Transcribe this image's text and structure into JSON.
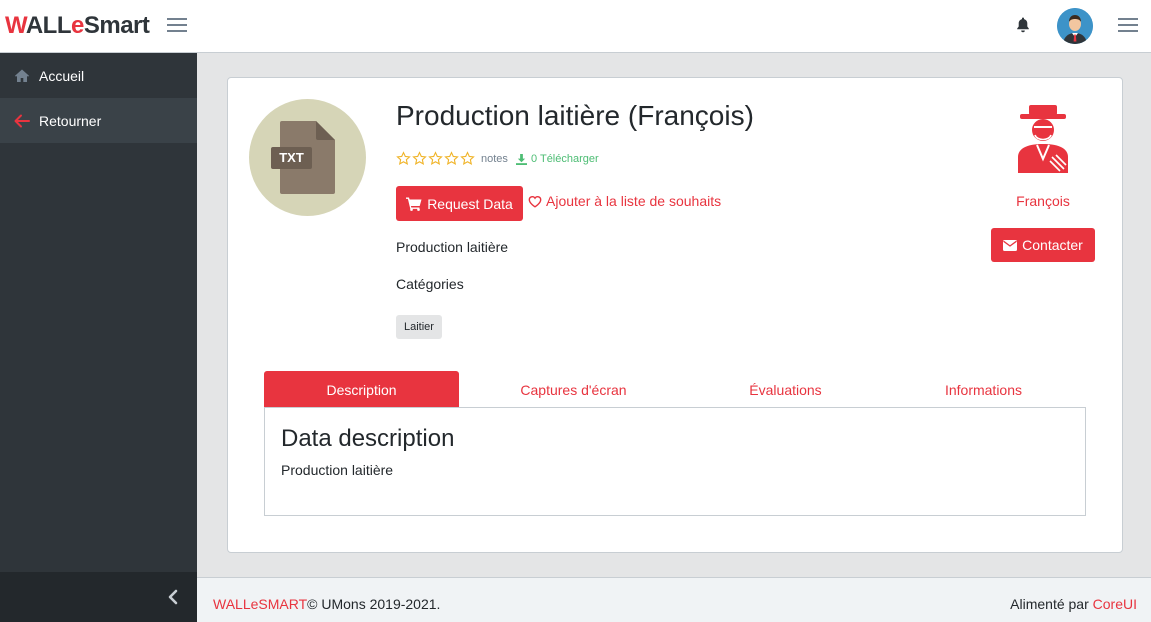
{
  "header": {
    "brand_w": "W",
    "brand_a": "A",
    "brand_ll": "LL",
    "brand_e": "e",
    "brand_smart": "Smart",
    "accent_color": "#e8343f"
  },
  "sidebar": {
    "items": [
      {
        "label": "Accueil",
        "icon": "home-icon"
      },
      {
        "label": "Retourner",
        "icon": "arrow-left-icon"
      }
    ]
  },
  "product": {
    "file_type": "TXT",
    "title": "Production laitière (François)",
    "rating_stars": 5,
    "rating_value": 0,
    "notes_label": "notes",
    "download_label": "0 Télécharger",
    "request_button": "Request Data",
    "wishlist_label": "Ajouter à la liste de souhaits",
    "description": "Production laitière",
    "categories_label": "Catégories",
    "tag": "Laitier"
  },
  "owner": {
    "name": "François",
    "contact_button": "Contacter"
  },
  "tabs": [
    {
      "label": "Description",
      "active": true
    },
    {
      "label": "Captures d'écran",
      "active": false
    },
    {
      "label": "Évaluations",
      "active": false
    },
    {
      "label": "Informations",
      "active": false
    }
  ],
  "tab_pane": {
    "title": "Data description",
    "text": "Production laitière"
  },
  "footer": {
    "brand_link": "WALLeSMART",
    "copyright": "© UMons 2019-2021.",
    "powered_by": "Alimenté par",
    "powered_link": "CoreUI"
  }
}
